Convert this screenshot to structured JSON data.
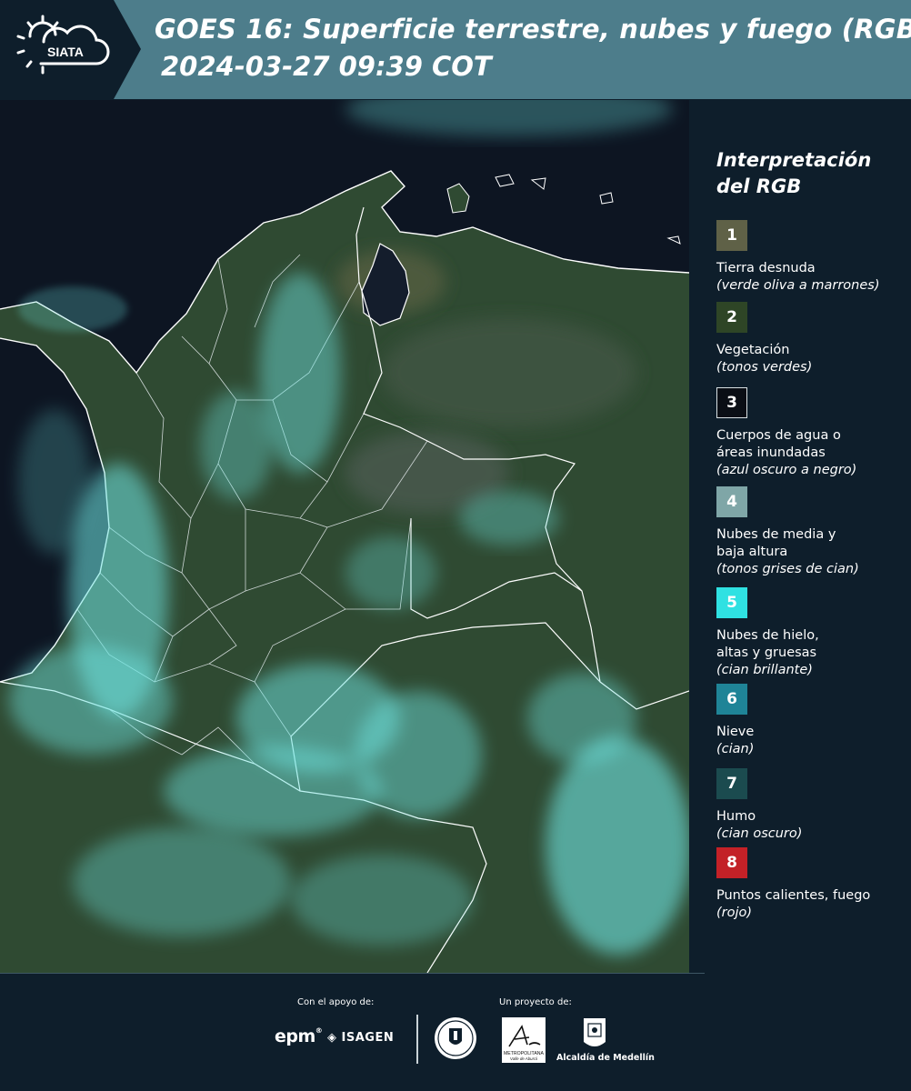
{
  "header": {
    "logo_text": "SIATA",
    "title_line1": "GOES 16: Superficie terrestre, nubes y fuego (RGB)",
    "title_line2": "2024-03-27 09:39 COT"
  },
  "legend": {
    "title": "Interpretación del RGB",
    "items": [
      {
        "number": "1",
        "label": "Tierra desnuda",
        "hint": "(verde oliva a marrones)",
        "color": "#5f6147"
      },
      {
        "number": "2",
        "label": "Vegetación",
        "hint": "(tonos verdes)",
        "color": "#2e4526"
      },
      {
        "number": "3",
        "label": "Cuerpos de agua o áreas inundadas",
        "hint": "(azul oscuro a negro)",
        "color": "#0a0e15"
      },
      {
        "number": "4",
        "label": "Nubes de media y baja altura",
        "hint": "(tonos grises de cian)",
        "color": "#7fa6a7"
      },
      {
        "number": "5",
        "label": "Nubes de hielo, altas y gruesas",
        "hint": "(cian brillante)",
        "color": "#2fe1e2"
      },
      {
        "number": "6",
        "label": "Nieve",
        "hint": "(cian)",
        "color": "#1f8497"
      },
      {
        "number": "7",
        "label": "Humo",
        "hint": "(cian oscuro)",
        "color": "#1b4b4f"
      },
      {
        "number": "8",
        "label": "Puntos calientes, fuego",
        "hint": "(rojo)",
        "color": "#c32127"
      }
    ]
  },
  "footer": {
    "support_label": "Con el apoyo de:",
    "project_label": "Un proyecto de:",
    "epm": "epm",
    "isagen": "ISAGEN",
    "area_name": "METROPOLITANA",
    "area_sub": "Valle de Aburrá",
    "alcaldia": "Alcaldía de Medellín"
  },
  "colors": {
    "header_bg": "#4d7d8b",
    "page_bg": "#0e1e2b",
    "ocean": "#0d1522",
    "vegetation": "#2f4a32",
    "cloud": "#6fe6e3"
  }
}
